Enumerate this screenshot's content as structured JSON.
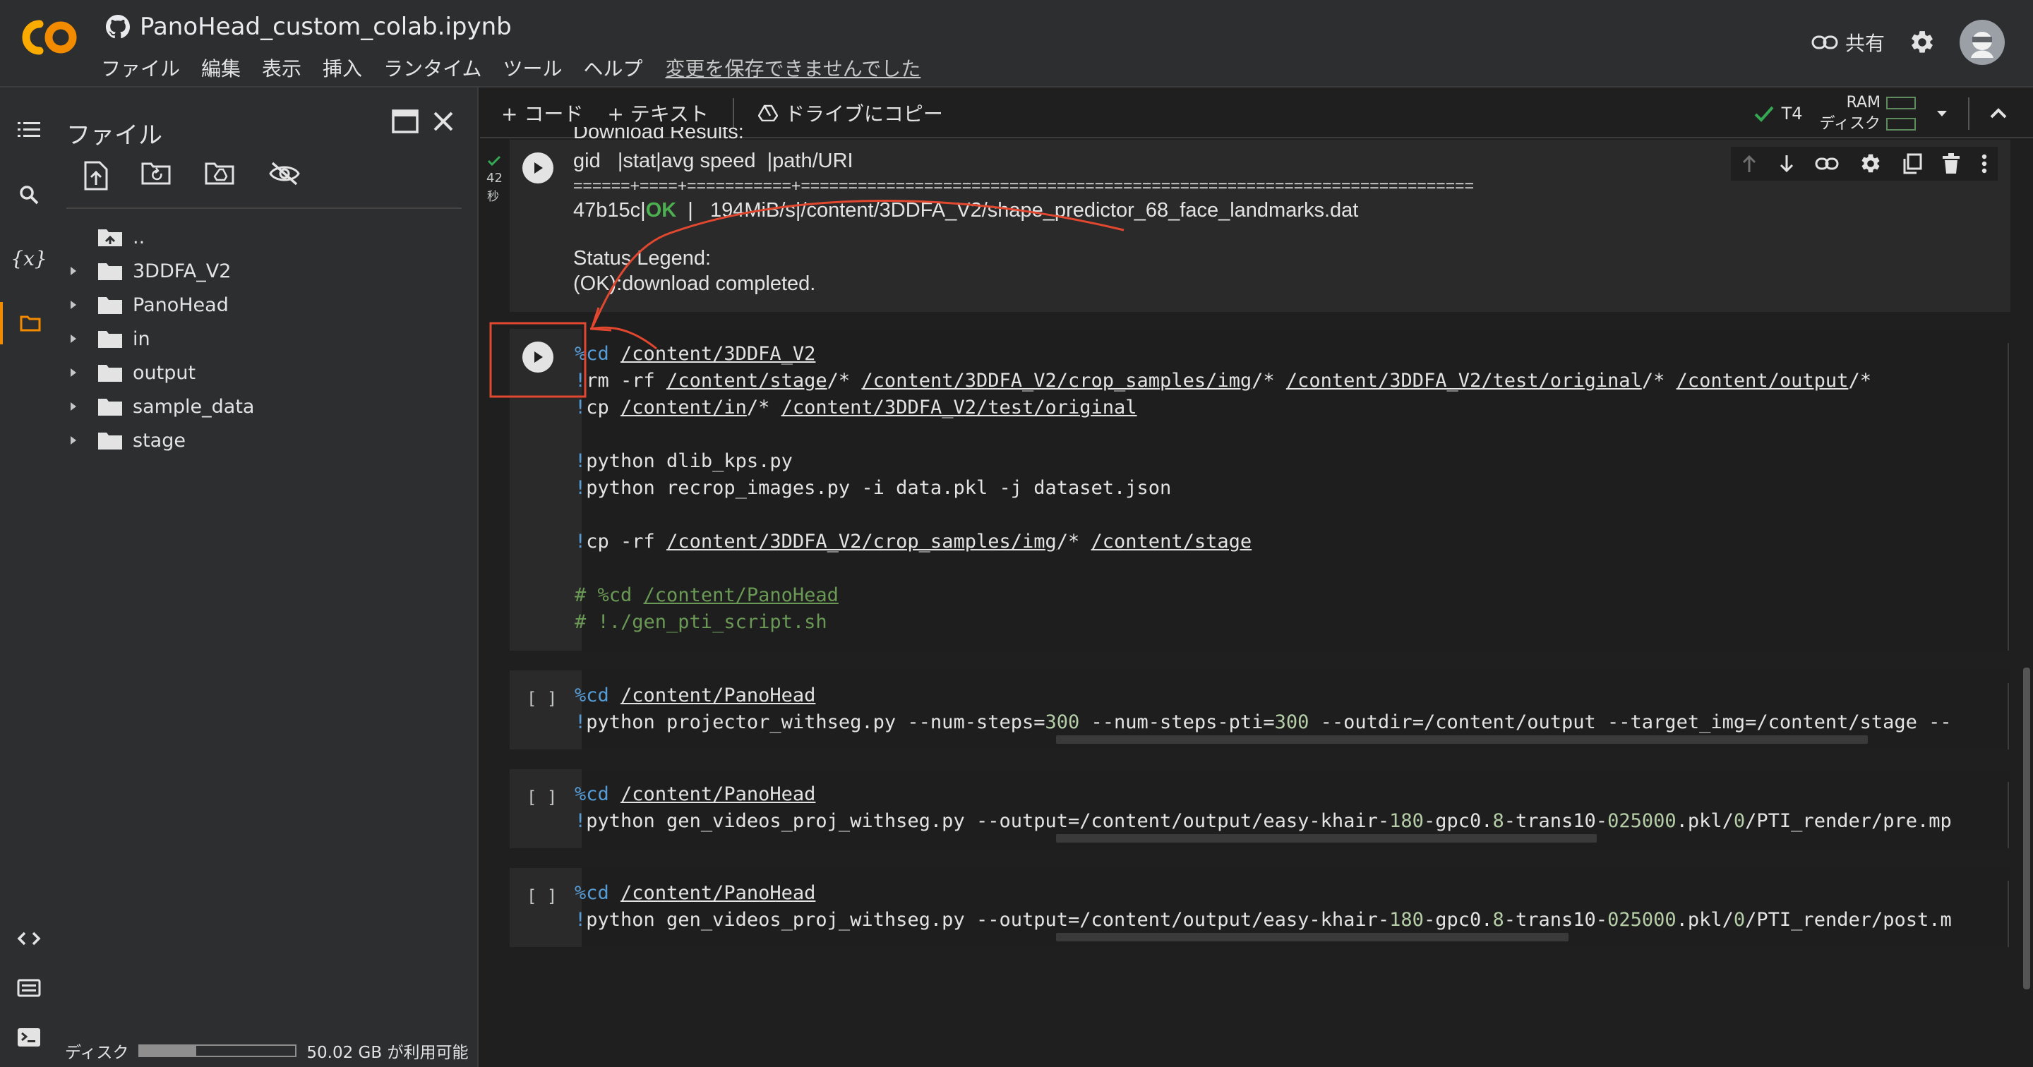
{
  "app": {
    "title": "PanoHead_custom_colab.ipynb",
    "share_label": "共有"
  },
  "menu": [
    "ファイル",
    "編集",
    "表示",
    "挿入",
    "ランタイム",
    "ツール",
    "ヘルプ"
  ],
  "unsaved_notice": "変更を保存できませんでした",
  "toolbar": {
    "add_code": "+ コード",
    "add_text": "+ テキスト",
    "copy_to_drive": "ドライブにコピー",
    "runtime": "T4",
    "ram_label": "RAM",
    "disk_label": "ディスク"
  },
  "sidebar": {
    "panel_title": "ファイル",
    "items": [
      {
        "name": "..",
        "type": "parent"
      },
      {
        "name": "3DDFA_V2",
        "type": "folder"
      },
      {
        "name": "PanoHead",
        "type": "folder"
      },
      {
        "name": "in",
        "type": "folder"
      },
      {
        "name": "output",
        "type": "folder"
      },
      {
        "name": "sample_data",
        "type": "folder"
      },
      {
        "name": "stage",
        "type": "folder"
      }
    ],
    "disk_label": "ディスク",
    "disk_free": "50.02 GB が利用可能",
    "disk_used_fraction": 0.36
  },
  "cells": {
    "output_cell": {
      "exec_time": "42",
      "exec_unit": "秒",
      "lines": {
        "l0": "Download Results:",
        "l1": "gid   |stat|avg speed  |path/URI",
        "l2": "======+====+===========+=======================================================================",
        "l3a": "47b15c|",
        "l3b": "OK",
        "l3c": "  |   194MiB/s|/content/3DDFA_V2/shape_predictor_68_face_landmarks.dat",
        "l4": "Status Legend:",
        "l5": "(OK):download completed."
      }
    },
    "main_cell": {
      "lines": {
        "a1": "%cd",
        "a2": "/content/3DDFA_V2",
        "b1": "!",
        "b2": "rm -rf ",
        "b3": "/content/stage",
        "b4": "/* ",
        "b5": "/content/3DDFA_V2/crop_samples/img",
        "b6": "/* ",
        "b7": "/content/3DDFA_V2/test/original",
        "b8": "/* ",
        "b9": "/content/output",
        "b10": "/*",
        "c1": "!",
        "c2": "cp ",
        "c3": "/content/in",
        "c4": "/* ",
        "c5": "/content/3DDFA_V2/test/original",
        "d1": "!",
        "d2": "python dlib_kps.py",
        "e1": "!",
        "e2": "python recrop_images.py -i data.pkl -j dataset.json",
        "f1": "!",
        "f2": "cp -rf ",
        "f3": "/content/3DDFA_V2/crop_samples/img",
        "f4": "/* ",
        "f5": "/content/stage",
        "g1": "# %cd ",
        "g2": "/content/PanoHead",
        "h1": "# !./gen_pti_script.sh"
      }
    },
    "cell3": {
      "bracket": "[ ]",
      "l1a": "%cd",
      "l1b": "/content/PanoHead",
      "l2a": "!",
      "l2b": "python projector_withseg.py --num-steps=",
      "l2c": "300",
      "l2d": " --num-steps-pti=",
      "l2e": "300",
      "l2f": " --outdir=/content/output --target_img=/content/stage --"
    },
    "cell4": {
      "bracket": "[ ]",
      "l1a": "%cd",
      "l1b": "/content/PanoHead",
      "l2a": "!",
      "l2b": "python gen_videos_proj_withseg.py --output=/content/output/easy-khair-",
      "l2c": "180",
      "l2d": "-gpc0.",
      "l2e": "8",
      "l2f": "-trans10-",
      "l2g": "025000",
      "l2h": ".pkl/",
      "l2i": "0",
      "l2j": "/PTI_render/pre.mp"
    },
    "cell5": {
      "bracket": "[ ]",
      "l1a": "%cd",
      "l1b": "/content/PanoHead",
      "l2a": "!",
      "l2b": "python gen_videos_proj_withseg.py --output=/content/output/easy-khair-",
      "l2c": "180",
      "l2d": "-gpc0.",
      "l2e": "8",
      "l2f": "-trans10-",
      "l2g": "025000",
      "l2h": ".pkl/",
      "l2i": "0",
      "l2j": "/PTI_render/post.m"
    }
  },
  "colors": {
    "accent_orange": "#f28b00",
    "annotation_red": "#e2472f",
    "ok_green": "#4caf50",
    "keyword_blue": "#569cd6",
    "comment_green": "#6a9955"
  }
}
